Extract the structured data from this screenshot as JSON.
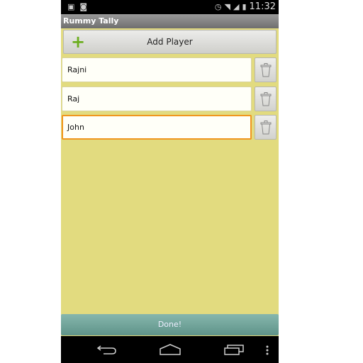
{
  "status_bar": {
    "time": "11:32",
    "icons": [
      "image-icon",
      "camera-icon",
      "alarm-icon",
      "wifi-icon",
      "signal-icon",
      "battery-icon"
    ]
  },
  "app": {
    "title": "Rummy Tally"
  },
  "add_player": {
    "label": "Add Player",
    "icon": "plus-icon"
  },
  "players": [
    {
      "name": "Rajni",
      "focused": false
    },
    {
      "name": "Raj",
      "focused": false
    },
    {
      "name": "John",
      "focused": true
    }
  ],
  "done_label": "Done!",
  "nav_bar": {
    "buttons": [
      "back-icon",
      "home-icon",
      "recent-apps-icon",
      "overflow-menu-icon"
    ]
  },
  "colors": {
    "background": "#e2db7f",
    "focus": "#f0961e",
    "done": "#72a59b",
    "plus": "#6cae1f"
  }
}
